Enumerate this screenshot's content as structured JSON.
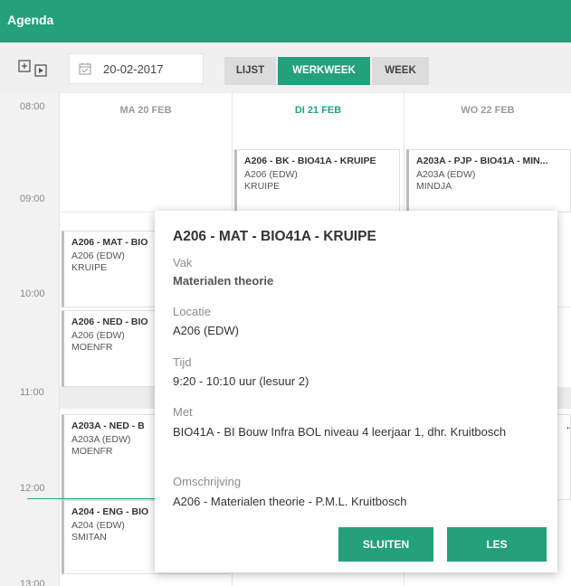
{
  "app": {
    "title": "Agenda"
  },
  "toolbar": {
    "date_value": "20-02-2017",
    "views": {
      "lijst": "LIJST",
      "werkweek": "WERKWEEK",
      "week": "WEEK"
    },
    "active_view": "WERKWEEK"
  },
  "calendar": {
    "times": [
      "08:00",
      "09:00",
      "10:00",
      "11:00",
      "12:00",
      "13:00"
    ],
    "days": [
      {
        "label": "MA 20 FEB",
        "active": false
      },
      {
        "label": "DI 21 FEB",
        "active": true
      },
      {
        "label": "WO 22 FEB",
        "active": false
      }
    ],
    "events": {
      "tue_1": {
        "title": "A206 - BK - BIO41A - KRUIPE",
        "location": "A206 (EDW)",
        "teacher": "KRUIPE"
      },
      "wed_1": {
        "title": "A203A - PJP - BIO41A - MIN...",
        "location": "A203A (EDW)",
        "teacher": "MINDJA"
      },
      "mon_1": {
        "title": "A206 - MAT - BIO",
        "location": "A206 (EDW)",
        "teacher": "KRUIPE"
      },
      "mon_2": {
        "title": "A206 - NED - BIO",
        "location": "A206 (EDW)",
        "teacher": "MOENFR"
      },
      "mon_3": {
        "title": "A203A - NED - B",
        "location": "A203A (EDW)",
        "teacher": "MOENFR"
      },
      "mon_4": {
        "title": "A204 - ENG - BIO",
        "location": "A204 (EDW)",
        "teacher": "SMITAN"
      },
      "wed_2": {
        "title": "..."
      }
    }
  },
  "popup": {
    "title": "A206 - MAT - BIO41A - KRUIPE",
    "vak_label": "Vak",
    "vak_value": "Materialen theorie",
    "locatie_label": "Locatie",
    "locatie_value": "A206 (EDW)",
    "tijd_label": "Tijd",
    "tijd_value": "9:20 - 10:10 uur (lesuur 2)",
    "met_label": "Met",
    "met_value": "BIO41A - BI Bouw Infra BOL niveau 4 leerjaar 1, dhr. Kruitbosch",
    "omschrijving_label": "Omschrijving",
    "omschrijving_value": "A206 - Materialen theorie - P.M.L. Kruitbosch",
    "btn_sluiten": "SLUITEN",
    "btn_les": "LES"
  },
  "colors": {
    "accent": "#24a07a",
    "toolbar_bg": "#f0f0f0",
    "time_col_bg": "#f2f2f2"
  },
  "icons": {
    "toggle": "expand-collapse-icon",
    "date": "calendar-icon"
  }
}
